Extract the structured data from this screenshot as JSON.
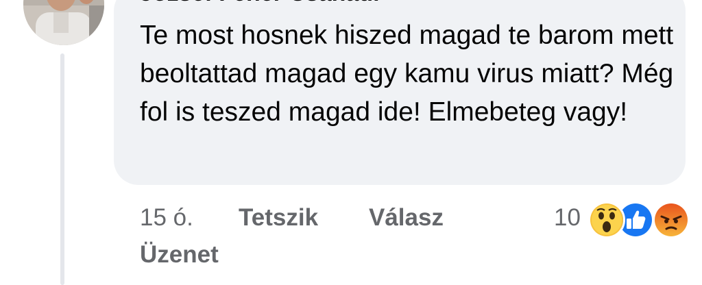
{
  "comment": {
    "author": "József Fehér Csanádi",
    "text": "Te most hosnek hiszed magad te barom mett beoltattad magad egy kamu virus miatt? Még fol is teszed magad ide! Elmebeteg vagy!"
  },
  "actions": {
    "time": "15 ó.",
    "like_label": "Tetszik",
    "reply_label": "Válasz",
    "message_label": "Üzenet"
  },
  "reactions": {
    "count": "10",
    "types": [
      "wow",
      "like",
      "angry"
    ]
  },
  "colors": {
    "bubble_bg": "#f0f2f5",
    "meta_text": "#65676b",
    "like_blue": "#1877f2"
  }
}
